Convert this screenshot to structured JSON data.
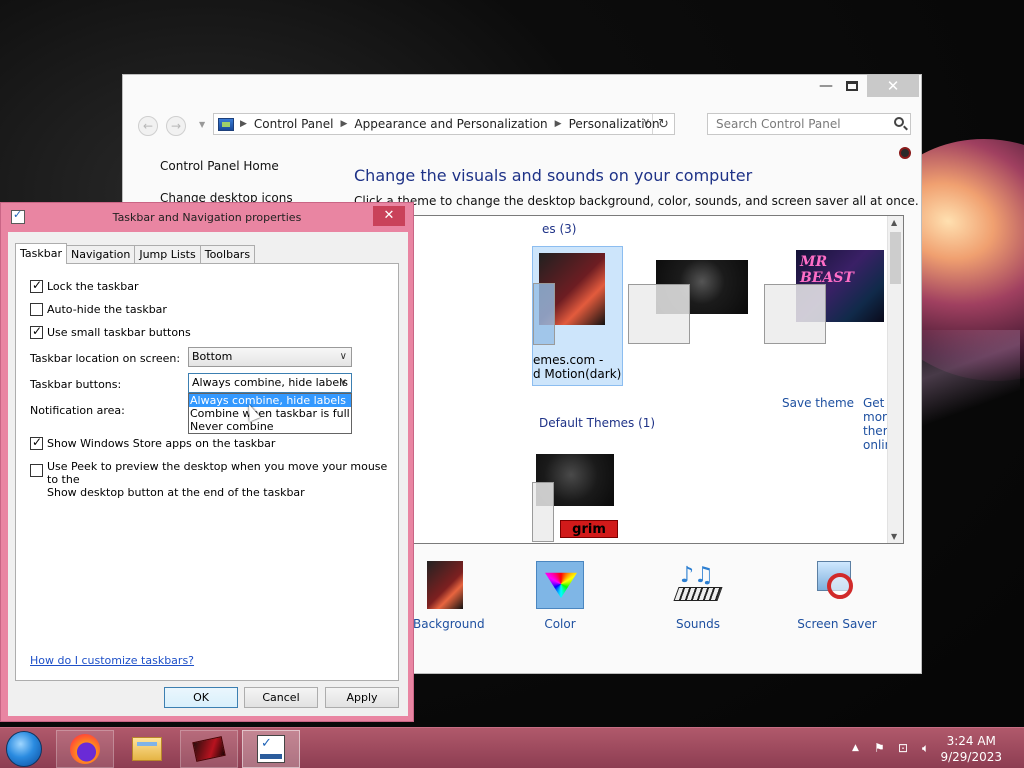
{
  "control_panel": {
    "address": {
      "crumbs": [
        "Control Panel",
        "Appearance and Personalization",
        "Personalization"
      ]
    },
    "search_placeholder": "Search Control Panel",
    "sidebar": {
      "home": "Control Panel Home",
      "desktop_icons": "Change desktop icons"
    },
    "heading": "Change the visuals and sounds on your computer",
    "subheading": "Click a theme to change the desktop background, color, sounds, and screen saver all at once.",
    "my_themes_group": "es (3)",
    "selected_theme_name_line1": "emes.com -",
    "selected_theme_name_line2": "d Motion(dark)",
    "save_theme": "Save theme",
    "get_more_themes": "Get more themes online",
    "default_themes_group": "Default Themes (1)",
    "bottom": {
      "background": "Background",
      "color": "Color",
      "sounds": "Sounds",
      "screen_saver": "Screen Saver"
    },
    "poster_text": "MR BEAST",
    "grim_text": "grim"
  },
  "dialog": {
    "title": "Taskbar and Navigation properties",
    "tabs": [
      "Taskbar",
      "Navigation",
      "Jump Lists",
      "Toolbars"
    ],
    "lock_taskbar": "Lock the taskbar",
    "auto_hide": "Auto-hide the taskbar",
    "small_buttons": "Use small taskbar buttons",
    "location_label": "Taskbar location on screen:",
    "location_value": "Bottom",
    "buttons_label": "Taskbar buttons:",
    "buttons_value": "Always combine, hide labels",
    "buttons_options": [
      "Always combine, hide labels",
      "Combine when taskbar is full",
      "Never combine"
    ],
    "notification_label": "Notification area:",
    "store_apps": "Show Windows Store apps on the taskbar",
    "peek_line1": "Use Peek to preview the desktop when you move your mouse to the",
    "peek_line2": "Show desktop button at the end of the taskbar",
    "help_link": "How do I customize taskbars?",
    "ok": "OK",
    "cancel": "Cancel",
    "apply": "Apply"
  },
  "taskbar": {
    "time": "3:24 AM",
    "date": "9/29/2023"
  }
}
